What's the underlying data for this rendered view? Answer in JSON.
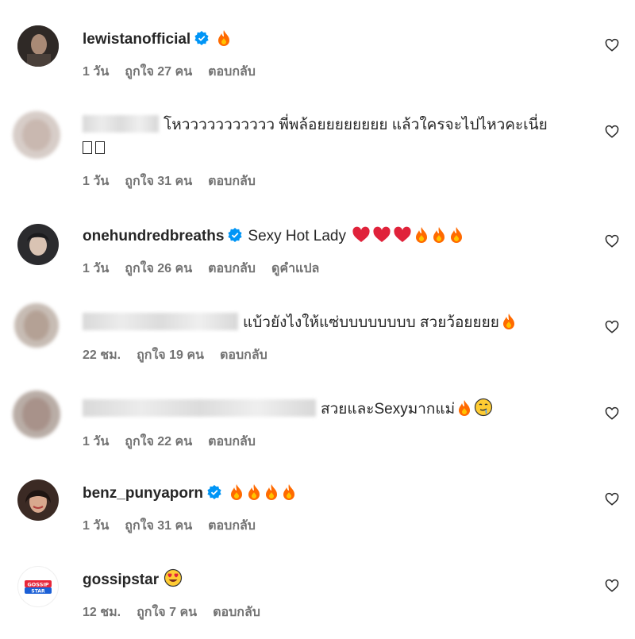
{
  "comments": [
    {
      "username": "lewistanofficial",
      "verified": true,
      "text": "",
      "emojis": [
        "fire"
      ],
      "time": "1 วัน",
      "likes": "ถูกใจ 27 คน",
      "reply": "ตอบกลับ",
      "translate": ""
    },
    {
      "username": "",
      "verified": false,
      "text": "โหววววววววววว พี่พล้อยยยยยยยย แล้วใครจะไปไหวคะเนี่ย",
      "emojis": [],
      "time": "1 วัน",
      "likes": "ถูกใจ 31 คน",
      "reply": "ตอบกลับ",
      "translate": ""
    },
    {
      "username": "onehundredbreaths",
      "verified": true,
      "text": "Sexy Hot Lady",
      "emojis": [
        "heart",
        "heart",
        "heart",
        "fire",
        "fire",
        "fire"
      ],
      "time": "1 วัน",
      "likes": "ถูกใจ 26 คน",
      "reply": "ตอบกลับ",
      "translate": "ดูคำแปล"
    },
    {
      "username": "",
      "verified": false,
      "text": "แบ้วยังไงให้แซ่บบบบบบบบ สวยว้อยยยย",
      "emojis": [
        "fire"
      ],
      "time": "22 ชม.",
      "likes": "ถูกใจ 19 คน",
      "reply": "ตอบกลับ",
      "translate": ""
    },
    {
      "username": "",
      "verified": false,
      "text": "สวยและSexyมากแม่",
      "emojis": [
        "fire",
        "drool"
      ],
      "time": "1 วัน",
      "likes": "ถูกใจ 22 คน",
      "reply": "ตอบกลับ",
      "translate": ""
    },
    {
      "username": "benz_punyaporn",
      "verified": true,
      "text": "",
      "emojis": [
        "fire",
        "fire",
        "fire",
        "fire"
      ],
      "time": "1 วัน",
      "likes": "ถูกใจ 31 คน",
      "reply": "ตอบกลับ",
      "translate": ""
    },
    {
      "username": "gossipstar",
      "verified": false,
      "text": "",
      "emojis": [
        "heart-eyes"
      ],
      "time": "12 ชม.",
      "likes": "ถูกใจ 7 คน",
      "reply": "ตอบกลับ",
      "translate": ""
    }
  ],
  "avatar_logo_text": "GOSSIP STAR",
  "colors": {
    "meta": "#737373",
    "verified": "#0095f6",
    "fire": "#ff6a00",
    "heart": "#e0223a"
  }
}
